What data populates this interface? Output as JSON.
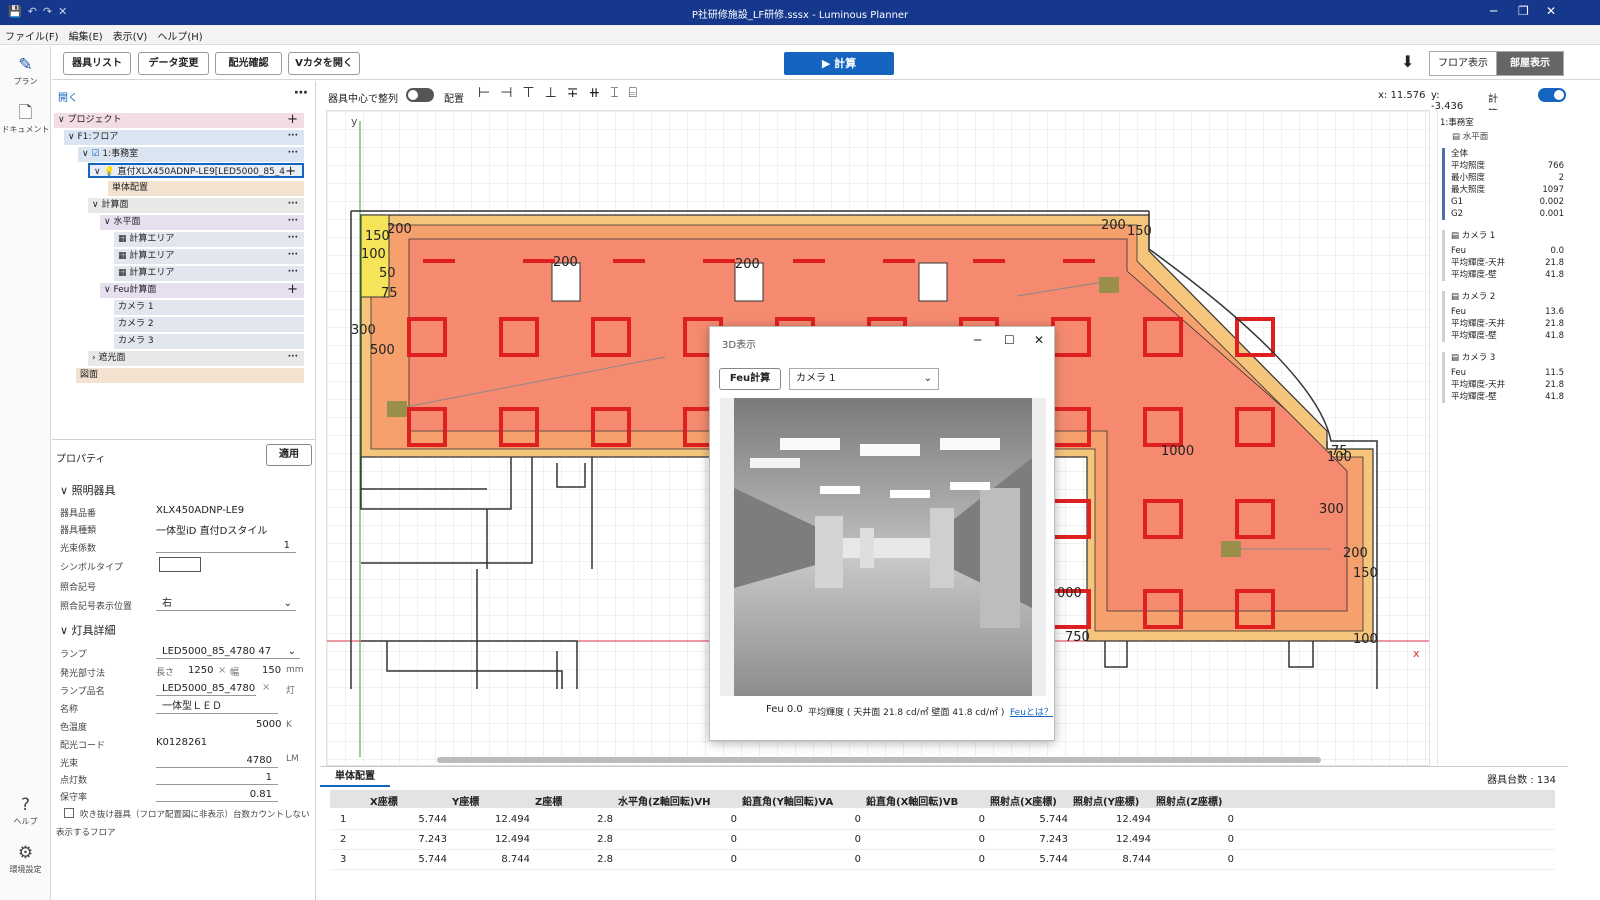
{
  "window": {
    "title": "P社研修施設_LF研修.sssx - Luminous Planner",
    "minimize": "─",
    "restore": "❐",
    "close": "✕"
  },
  "menu": [
    "ファイル(F)",
    "編集(E)",
    "表示(V)",
    "ヘルプ(H)"
  ],
  "toolbar": {
    "fixture_list": "器具リスト",
    "data_change": "データ変更",
    "light_check": "配光確認",
    "vcatalog": "Vカタを開く",
    "calc": "▶ 計算",
    "floor_view": "フロア表示",
    "room_view": "部屋表示"
  },
  "rail": {
    "plan": "プラン",
    "document": "ドキュメント",
    "help": "ヘルプ",
    "settings": "環境設定"
  },
  "tree": {
    "open": "開く",
    "items": [
      {
        "label": "プロジェクト"
      },
      {
        "label": "F1:フロア"
      },
      {
        "label": "1:事務室"
      },
      {
        "label": "直付XLX450ADNP-LE9[LED5000_85_4"
      },
      {
        "label": "単体配置"
      },
      {
        "label": "計算面"
      },
      {
        "label": "水平面"
      },
      {
        "label": "計算エリア"
      },
      {
        "label": "計算エリア"
      },
      {
        "label": "計算エリア"
      },
      {
        "label": "Feu計算面"
      },
      {
        "label": "カメラ 1"
      },
      {
        "label": "カメラ 2"
      },
      {
        "label": "カメラ 3"
      },
      {
        "label": "遮光面"
      },
      {
        "label": "図面"
      }
    ]
  },
  "props": {
    "title": "プロパティ",
    "apply": "適用",
    "sec_fixture": "照明器具",
    "sec_lamp": "灯具詳細",
    "fixture_no_label": "器具品番",
    "fixture_no": "XLX450ADNP-LE9",
    "fixture_type_label": "器具種類",
    "fixture_type": "一体型iD 直付Dスタイル",
    "flux_factor_label": "光束係数",
    "flux_factor": "1",
    "symbol_label": "シンボルタイプ",
    "code_label": "照合記号",
    "code_pos_label": "照合記号表示位置",
    "code_pos": "右",
    "lamp_label": "ランプ",
    "lamp": "LED5000_85_4780",
    "lamp_extra": "47",
    "size_label": "発光部寸法",
    "size_l_label": "長さ",
    "size_l": "1250",
    "times": "×",
    "size_w_label": "幅",
    "size_w": "150",
    "size_unit": "mm",
    "lamp_name_label": "ランプ品名",
    "lamp_name": "LED5000_85_4780",
    "lamp_count_unit": "灯",
    "name_label": "名称",
    "name": "一体型ＬＥＤ",
    "ct_label": "色温度",
    "ct": "5000",
    "ct_unit": "K",
    "dist_label": "配光コード",
    "dist": "K0128261",
    "flux_label": "光束",
    "flux": "4780",
    "flux_unit": "LM",
    "count_label": "点灯数",
    "count": "1",
    "maint_label": "保守率",
    "maint": "0.81",
    "atrium": "吹き抜け器具（フロア配置図に非表示）台数カウントしない",
    "floor_show": "表示するフロア"
  },
  "canvas": {
    "align_center": "器具中心で整列",
    "arrange": "配置",
    "coord_x": "x: 11.576",
    "coord_y": "y: -3.436",
    "calc_result": "計算結果",
    "axis_y": "y",
    "axis_x": "x",
    "labels": [
      "200",
      "150",
      "100",
      "50",
      "75",
      "300",
      "500",
      "200",
      "200",
      "200",
      "150",
      "75",
      "100",
      "1000",
      "300",
      "200",
      "150",
      "000",
      "750",
      "100"
    ]
  },
  "win3d": {
    "title": "3D表示",
    "feu_btn": "Feu計算",
    "camera": "カメラ 1",
    "feu_value": "Feu 0.0",
    "stats": "平均輝度 ( 天井面 21.8 cd/㎡ 壁面 41.8 cd/㎡ )",
    "link": "Feuとは？"
  },
  "right": {
    "room": "1:事務室",
    "plane": "水平面",
    "all": "全体",
    "avg_lbl": "平均照度",
    "avg": "766",
    "min_lbl": "最小照度",
    "min": "2",
    "max_lbl": "最大照度",
    "max": "1097",
    "g1_lbl": "G1",
    "g1": "0.002",
    "g2_lbl": "G2",
    "g2": "0.001",
    "cams": [
      {
        "name": "カメラ 1",
        "feu": "0.0",
        "ceil": "21.8",
        "wall": "41.8"
      },
      {
        "name": "カメラ 2",
        "feu": "13.6",
        "ceil": "21.8",
        "wall": "41.8"
      },
      {
        "name": "カメラ 3",
        "feu": "11.5",
        "ceil": "21.8",
        "wall": "41.8"
      }
    ],
    "feu_lbl": "Feu",
    "ceil_lbl": "平均輝度-天井",
    "wall_lbl": "平均輝度-壁"
  },
  "bottom": {
    "tab": "単体配置",
    "count": "器具台数 : 134",
    "headers": [
      "X座標",
      "Y座標",
      "Z座標",
      "水平角(Z軸回転)VH",
      "鉛直角(Y軸回転)VA",
      "鉛直角(X軸回転)VB",
      "照射点(X座標)",
      "照射点(Y座標)",
      "照射点(Z座標)"
    ],
    "rows": [
      [
        "1",
        "5.744",
        "12.494",
        "2.8",
        "0",
        "0",
        "0",
        "5.744",
        "12.494",
        "0"
      ],
      [
        "2",
        "7.243",
        "12.494",
        "2.8",
        "0",
        "0",
        "0",
        "7.243",
        "12.494",
        "0"
      ],
      [
        "3",
        "5.744",
        "8.744",
        "2.8",
        "0",
        "0",
        "0",
        "5.744",
        "8.744",
        "0"
      ]
    ]
  }
}
